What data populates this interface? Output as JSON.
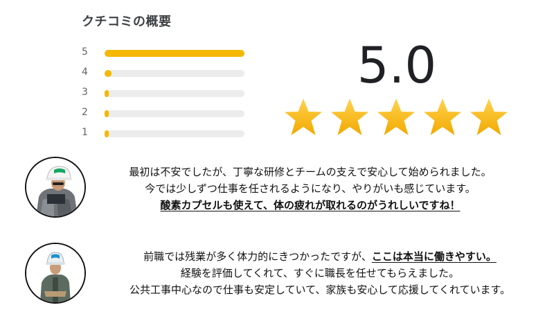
{
  "summary": {
    "title": "クチコミの概要",
    "score": "5.0",
    "star_count": 5,
    "star_color": "#f6b81a",
    "bar_color": "#f5b800",
    "track_color": "#ececec",
    "distribution": [
      {
        "label": "5",
        "fraction": 1.0
      },
      {
        "label": "4",
        "fraction": 0.05
      },
      {
        "label": "3",
        "fraction": 0.01
      },
      {
        "label": "2",
        "fraction": 0.01
      },
      {
        "label": "1",
        "fraction": 0.01
      }
    ]
  },
  "reviews": [
    {
      "avatar": "worker-white-helmet-avatar",
      "line1": "最初は不安でしたが、丁寧な研修とチームの支えで安心して始められました。",
      "line2": "今では少しずつ仕事を任されるようになり、やりがいも感じています。",
      "line3_bold": "酸素カプセルも使えて、体の疲れが取れるのがうれしいですね！"
    },
    {
      "avatar": "worker-blue-helmet-avatar",
      "line1_prefix": "前職では残業が多く体力的にきつかったですが、",
      "line1_bold": "ここは本当に働きやすい。",
      "line2": "経験を評価してくれて、すぐに職長を任せてもらえました。",
      "line3": "公共工事中心なので仕事も安定していて、家族も安心して応援してくれています。"
    }
  ]
}
